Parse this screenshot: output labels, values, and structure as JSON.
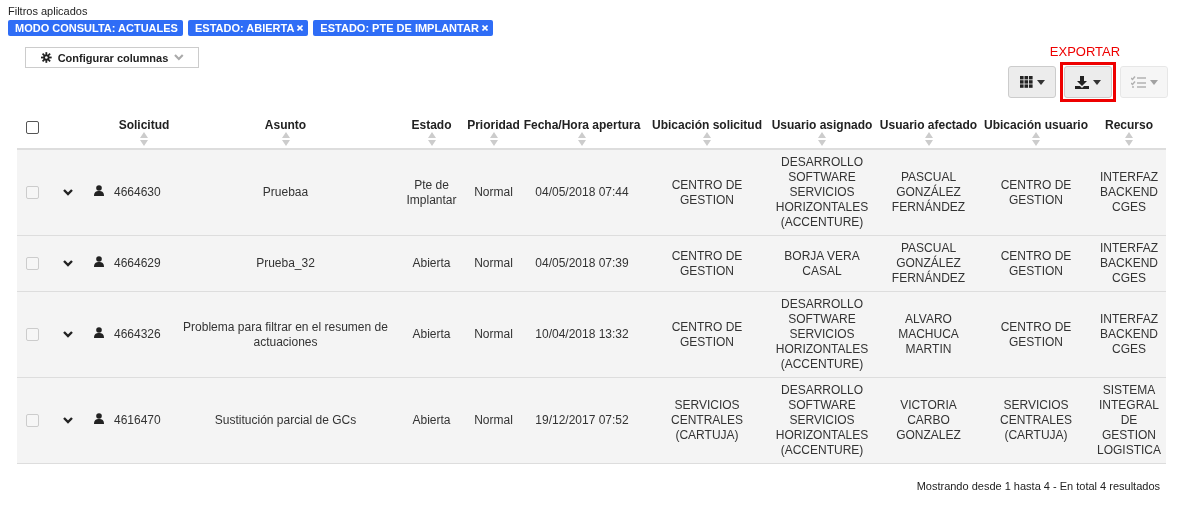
{
  "filters": {
    "title": "Filtros aplicados",
    "tags": [
      {
        "label": "MODO CONSULTA: ACTUALES",
        "removable": false
      },
      {
        "label": "ESTADO: ABIERTA",
        "removable": true
      },
      {
        "label": "ESTADO: PTE DE IMPLANTAR",
        "removable": true
      }
    ]
  },
  "configure_button": {
    "label": "Configurar columnas"
  },
  "toolbar": {
    "annotation": "EXPORTAR",
    "buttons": [
      {
        "kind": "columns",
        "disabled": false,
        "highlighted": false
      },
      {
        "kind": "export",
        "disabled": false,
        "highlighted": true
      },
      {
        "kind": "list",
        "disabled": true,
        "highlighted": false
      }
    ]
  },
  "table": {
    "select_all": {
      "checked": false
    },
    "columns": [
      {
        "label": "Solicitud"
      },
      {
        "label": "Asunto"
      },
      {
        "label": "Estado"
      },
      {
        "label": "Prioridad"
      },
      {
        "label": "Fecha/Hora apertura"
      },
      {
        "label": "Ubicación solicitud"
      },
      {
        "label": "Usuario asignado"
      },
      {
        "label": "Usuario afectado"
      },
      {
        "label": "Ubicación usuario"
      },
      {
        "label": "Recurso"
      }
    ],
    "rows": [
      {
        "checked": false,
        "cells": [
          "4664630",
          "Pruebaa",
          "Pte de Implantar",
          "Normal",
          "04/05/2018 07:44",
          "CENTRO DE GESTION",
          "DESARROLLO SOFTWARE SERVICIOS HORIZONTALES (ACCENTURE)",
          "PASCUAL GONZÁLEZ FERNÁNDEZ",
          "CENTRO DE GESTION",
          "INTERFAZ BACKEND CGES"
        ]
      },
      {
        "checked": false,
        "cells": [
          "4664629",
          "Prueba_32",
          "Abierta",
          "Normal",
          "04/05/2018 07:39",
          "CENTRO DE GESTION",
          "BORJA VERA CASAL",
          "PASCUAL GONZÁLEZ FERNÁNDEZ",
          "CENTRO DE GESTION",
          "INTERFAZ BACKEND CGES"
        ]
      },
      {
        "checked": false,
        "cells": [
          "4664326",
          "Problema para filtrar en el resumen de actuaciones",
          "Abierta",
          "Normal",
          "10/04/2018 13:32",
          "CENTRO DE GESTION",
          "DESARROLLO SOFTWARE SERVICIOS HORIZONTALES (ACCENTURE)",
          "ALVARO MACHUCA MARTIN",
          "CENTRO DE GESTION",
          "INTERFAZ BACKEND CGES"
        ]
      },
      {
        "checked": false,
        "cells": [
          "4616470",
          "Sustitución parcial de GCs",
          "Abierta",
          "Normal",
          "19/12/2017 07:52",
          "SERVICIOS CENTRALES (CARTUJA)",
          "DESARROLLO SOFTWARE SERVICIOS HORIZONTALES (ACCENTURE)",
          "VICTORIA CARBO GONZALEZ",
          "SERVICIOS CENTRALES (CARTUJA)",
          "SISTEMA INTEGRAL DE GESTION LOGISTICA"
        ]
      }
    ]
  },
  "footer": "Mostrando desde 1 hasta 4 - En total 4 resultados"
}
